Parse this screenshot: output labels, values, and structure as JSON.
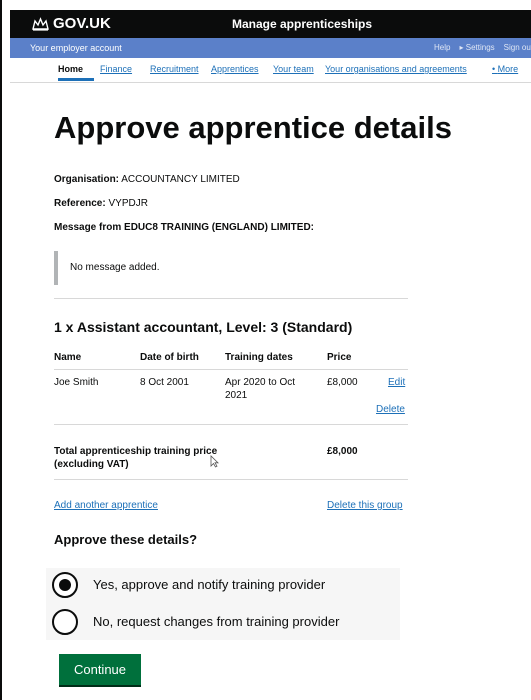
{
  "header": {
    "logo_text": "GOV.UK",
    "service_name": "Manage apprenticeships"
  },
  "subheader": {
    "account_label": "Your employer account",
    "utility_links": [
      "Help",
      "Settings",
      "Sign out"
    ]
  },
  "nav": {
    "items": [
      "Home",
      "Finance",
      "Recruitment",
      "Apprentices",
      "Your team",
      "Your organisations and agreements",
      "More"
    ],
    "active": "Home"
  },
  "page": {
    "title": "Approve apprentice details",
    "organisation_label": "Organisation:",
    "organisation_value": "ACCOUNTANCY LIMITED",
    "reference_label": "Reference:",
    "reference_value": "VYPDJR",
    "message_heading": "Message from EDUC8 TRAINING (ENGLAND) LIMITED:",
    "message_text": "No message added."
  },
  "group": {
    "heading": "1 x Assistant accountant, Level: 3 (Standard)",
    "columns": [
      "Name",
      "Date of birth",
      "Training dates",
      "Price"
    ],
    "rows": [
      {
        "name": "Joe Smith",
        "dob": "8 Oct 2001",
        "training_line1": "Apr 2020 to Oct",
        "training_line2": "2021",
        "price": "£8,000",
        "edit": "Edit",
        "delete": "Delete"
      }
    ],
    "total_label_line1": "Total apprenticeship training price",
    "total_label_line2": "(excluding VAT)",
    "total_value": "£8,000",
    "add_link": "Add another apprentice",
    "delete_group_link": "Delete this group"
  },
  "approval": {
    "question": "Approve these details?",
    "options": [
      {
        "label": "Yes, approve and notify training provider",
        "selected": true
      },
      {
        "label": "No, request changes from training provider",
        "selected": false
      }
    ],
    "continue_label": "Continue"
  },
  "colors": {
    "header_bg": "#0b0c0c",
    "account_bar": "#5b80c9",
    "link": "#1d70b8",
    "button": "#00703c"
  }
}
